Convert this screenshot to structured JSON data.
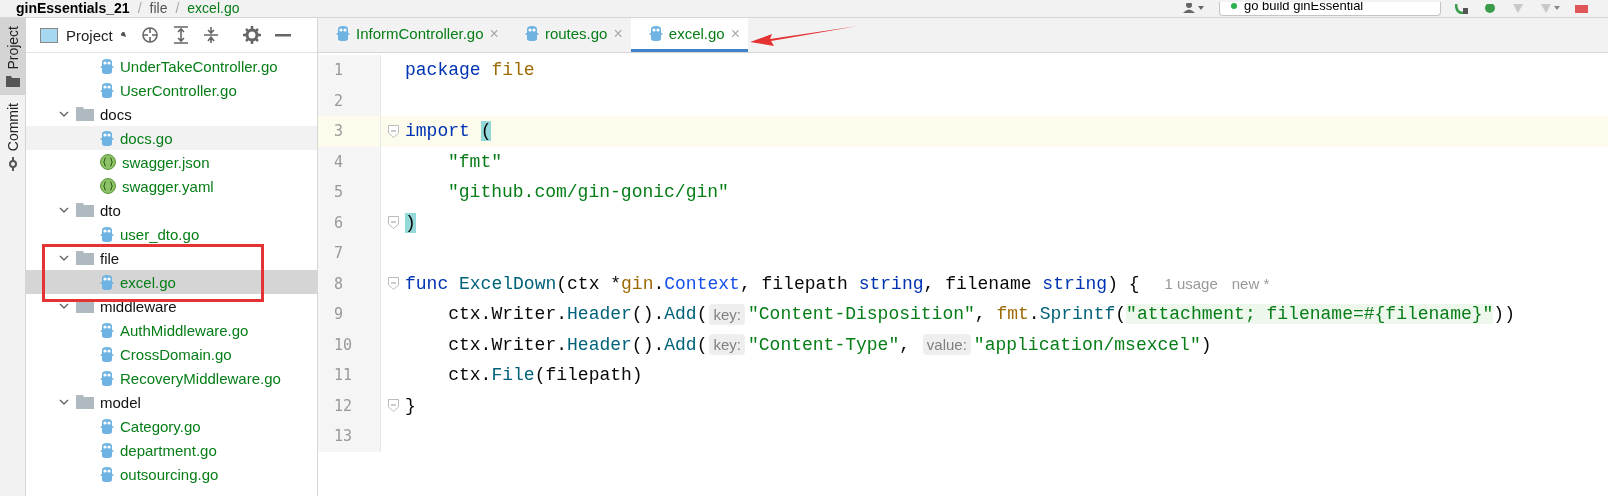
{
  "breadcrumb": [
    {
      "kind": "root",
      "text": "ginEssentials_21"
    },
    {
      "kind": "sep",
      "text": "/"
    },
    {
      "kind": "dir",
      "text": "file"
    },
    {
      "kind": "sep",
      "text": "/"
    },
    {
      "kind": "file",
      "text": "excel.go"
    }
  ],
  "run_config": {
    "label": "go build ginEssential"
  },
  "side_tabs": [
    {
      "label": "Project",
      "selected": true
    },
    {
      "label": "Commit",
      "selected": false
    }
  ],
  "project_panel": {
    "title": "Project"
  },
  "tree": [
    {
      "kind": "group",
      "children": [
        {
          "kind": "go",
          "label": "UnderTakeController.go",
          "selected": false,
          "hovered": false
        },
        {
          "kind": "go",
          "label": "UserController.go",
          "selected": false,
          "hovered": false
        }
      ]
    },
    {
      "kind": "folder",
      "label": "docs",
      "expanded": true,
      "children": [
        {
          "kind": "go",
          "label": "docs.go",
          "selected": false,
          "hovered": true
        },
        {
          "kind": "json",
          "label": "swagger.json",
          "selected": false,
          "hovered": false
        },
        {
          "kind": "json",
          "label": "swagger.yaml",
          "selected": false,
          "hovered": false
        }
      ]
    },
    {
      "kind": "folder",
      "label": "dto",
      "expanded": true,
      "children": [
        {
          "kind": "go",
          "label": "user_dto.go",
          "selected": false,
          "hovered": false
        }
      ]
    },
    {
      "kind": "folder",
      "label": "file",
      "expanded": true,
      "children": [
        {
          "kind": "go",
          "label": "excel.go",
          "selected": true,
          "hovered": false
        }
      ]
    },
    {
      "kind": "folder",
      "label": "middleware",
      "expanded": true,
      "children": [
        {
          "kind": "go",
          "label": "AuthMiddleware.go",
          "selected": false,
          "hovered": false
        },
        {
          "kind": "go",
          "label": "CrossDomain.go",
          "selected": false,
          "hovered": false
        },
        {
          "kind": "go",
          "label": "RecoveryMiddleware.go",
          "selected": false,
          "hovered": false
        }
      ]
    },
    {
      "kind": "folder",
      "label": "model",
      "expanded": true,
      "children": [
        {
          "kind": "go",
          "label": "Category.go",
          "selected": false,
          "hovered": false
        },
        {
          "kind": "go",
          "label": "department.go",
          "selected": false,
          "hovered": false
        },
        {
          "kind": "go",
          "label": "outsourcing.go",
          "selected": false,
          "hovered": false
        }
      ]
    }
  ],
  "tabs": [
    {
      "label": "InformController.go",
      "selected": false,
      "close": "×"
    },
    {
      "label": "routes.go",
      "selected": false,
      "close": "×"
    },
    {
      "label": "excel.go",
      "selected": true,
      "close": "×"
    }
  ],
  "code": [
    {
      "number": "1",
      "current": false,
      "fold": false,
      "tokens": [
        {
          "kind": "keyword",
          "text": "package "
        },
        {
          "kind": "pkg",
          "text": "file"
        }
      ]
    },
    {
      "number": "2",
      "current": false,
      "fold": false
    },
    {
      "number": "3",
      "current": true,
      "fold": true,
      "tokens": [
        {
          "kind": "keyword",
          "text": "import "
        },
        {
          "kind": "brace",
          "text": "("
        }
      ]
    },
    {
      "number": "4",
      "current": false,
      "fold": false,
      "indented": true,
      "tokens": [
        {
          "kind": "string",
          "text": "\"fmt\""
        }
      ]
    },
    {
      "number": "5",
      "current": false,
      "fold": false,
      "indented": true,
      "tokens": [
        {
          "kind": "string",
          "text": "\"github.com/gin-gonic/gin\""
        }
      ]
    },
    {
      "number": "6",
      "current": false,
      "fold": true,
      "tokens": [
        {
          "kind": "brace",
          "text": ")"
        }
      ]
    },
    {
      "number": "7",
      "current": false,
      "fold": false
    },
    {
      "number": "8",
      "current": false,
      "fold": true,
      "tokens": [
        {
          "kind": "keyword",
          "text": "func "
        },
        {
          "kind": "func",
          "text": "ExcelDown"
        },
        {
          "kind": "plain",
          "text": "(ctx *"
        },
        {
          "kind": "pkg",
          "text": "gin"
        },
        {
          "kind": "plain",
          "text": "."
        },
        {
          "kind": "type",
          "text": "Context"
        },
        {
          "kind": "plain",
          "text": ", filepath "
        },
        {
          "kind": "keyword",
          "text": "string"
        },
        {
          "kind": "plain",
          "text": ", filename "
        },
        {
          "kind": "keyword",
          "text": "string"
        },
        {
          "kind": "plain",
          "text": ") { "
        },
        {
          "kind": "lens",
          "text": "1 usage"
        },
        {
          "kind": "lens",
          "text": "new *"
        }
      ]
    },
    {
      "number": "9",
      "current": false,
      "fold": false,
      "tokens": [
        {
          "kind": "plain",
          "text": "    ctx.Writer."
        },
        {
          "kind": "func",
          "text": "Header"
        },
        {
          "kind": "plain",
          "text": "()."
        },
        {
          "kind": "func",
          "text": "Add"
        },
        {
          "kind": "plain",
          "text": "("
        },
        {
          "kind": "hint",
          "text": "key:"
        },
        {
          "kind": "string",
          "text": "\"Content-Disposition\""
        },
        {
          "kind": "plain",
          "text": ", "
        },
        {
          "kind": "pkg",
          "text": "fmt"
        },
        {
          "kind": "plain",
          "text": "."
        },
        {
          "kind": "func",
          "text": "Sprintf"
        },
        {
          "kind": "plain",
          "text": "("
        },
        {
          "kind": "injected",
          "text": "\"attachment; filename=#{filename}\""
        },
        {
          "kind": "plain",
          "text": "))"
        }
      ]
    },
    {
      "number": "10",
      "current": false,
      "fold": false,
      "tokens": [
        {
          "kind": "plain",
          "text": "    ctx.Writer."
        },
        {
          "kind": "func",
          "text": "Header"
        },
        {
          "kind": "plain",
          "text": "()."
        },
        {
          "kind": "func",
          "text": "Add"
        },
        {
          "kind": "plain",
          "text": "("
        },
        {
          "kind": "hint",
          "text": "key:"
        },
        {
          "kind": "string",
          "text": "\"Content-Type\""
        },
        {
          "kind": "plain",
          "text": ", "
        },
        {
          "kind": "hint",
          "text": "value:"
        },
        {
          "kind": "string",
          "text": "\"application/msexcel\""
        },
        {
          "kind": "plain",
          "text": ")"
        }
      ]
    },
    {
      "number": "11",
      "current": false,
      "fold": false,
      "tokens": [
        {
          "kind": "plain",
          "text": "    ctx."
        },
        {
          "kind": "func",
          "text": "File"
        },
        {
          "kind": "plain",
          "text": "(filepath)"
        }
      ]
    },
    {
      "number": "12",
      "current": false,
      "fold": true,
      "tokens": [
        {
          "kind": "plain",
          "text": "}"
        }
      ]
    },
    {
      "number": "13",
      "current": false,
      "fold": false
    }
  ]
}
